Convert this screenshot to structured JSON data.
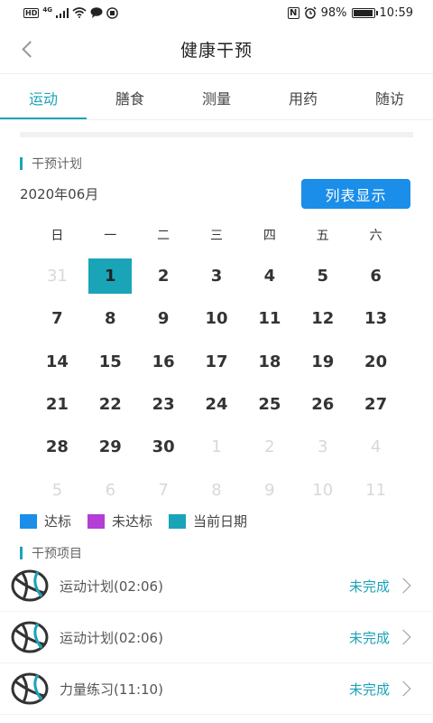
{
  "status_bar": {
    "hd": "HD",
    "network": "4G",
    "battery_text": "98%",
    "battery_level": 0.98,
    "time": "10:59",
    "nfc": "N"
  },
  "header": {
    "title": "健康干预"
  },
  "tabs": [
    {
      "label": "运动",
      "active": true
    },
    {
      "label": "膳食",
      "active": false
    },
    {
      "label": "测量",
      "active": false
    },
    {
      "label": "用药",
      "active": false
    },
    {
      "label": "随访",
      "active": false
    }
  ],
  "plan": {
    "section_title": "干预计划",
    "month": "2020年06月",
    "list_button": "列表显示"
  },
  "calendar": {
    "weekdays": [
      "日",
      "一",
      "二",
      "三",
      "四",
      "五",
      "六"
    ],
    "days": [
      {
        "d": "31",
        "muted": true
      },
      {
        "d": "1",
        "today": true
      },
      {
        "d": "2"
      },
      {
        "d": "3"
      },
      {
        "d": "4"
      },
      {
        "d": "5"
      },
      {
        "d": "6"
      },
      {
        "d": "7"
      },
      {
        "d": "8"
      },
      {
        "d": "9"
      },
      {
        "d": "10"
      },
      {
        "d": "11"
      },
      {
        "d": "12"
      },
      {
        "d": "13"
      },
      {
        "d": "14"
      },
      {
        "d": "15"
      },
      {
        "d": "16"
      },
      {
        "d": "17"
      },
      {
        "d": "18"
      },
      {
        "d": "19"
      },
      {
        "d": "20"
      },
      {
        "d": "21"
      },
      {
        "d": "22"
      },
      {
        "d": "23"
      },
      {
        "d": "24"
      },
      {
        "d": "25"
      },
      {
        "d": "26"
      },
      {
        "d": "27"
      },
      {
        "d": "28"
      },
      {
        "d": "29"
      },
      {
        "d": "30"
      },
      {
        "d": "1",
        "muted": true
      },
      {
        "d": "2",
        "muted": true
      },
      {
        "d": "3",
        "muted": true
      },
      {
        "d": "4",
        "muted": true
      },
      {
        "d": "5",
        "muted": true
      },
      {
        "d": "6",
        "muted": true
      },
      {
        "d": "7",
        "muted": true
      },
      {
        "d": "8",
        "muted": true
      },
      {
        "d": "9",
        "muted": true
      },
      {
        "d": "10",
        "muted": true
      },
      {
        "d": "11",
        "muted": true
      }
    ]
  },
  "legend": [
    {
      "label": "达标",
      "color": "#1a8ee8"
    },
    {
      "label": "未达标",
      "color": "#b43ed6"
    },
    {
      "label": "当前日期",
      "color": "#1aa4b8"
    }
  ],
  "items_section": {
    "title": "干预项目",
    "items": [
      {
        "label": "运动计划(02:06)",
        "status": "未完成",
        "icon": "basketball-icon"
      },
      {
        "label": "运动计划(02:06)",
        "status": "未完成",
        "icon": "basketball-icon"
      },
      {
        "label": "力量练习(11:10)",
        "status": "未完成",
        "icon": "basketball-icon"
      }
    ]
  },
  "colors": {
    "accent": "#1aa4b8",
    "button": "#1a8ee8"
  }
}
